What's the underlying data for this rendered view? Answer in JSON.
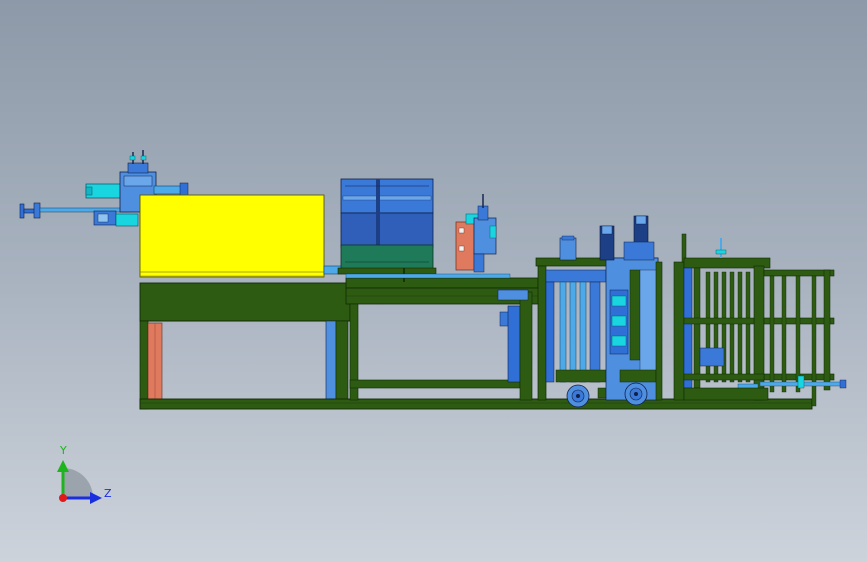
{
  "viewport": {
    "background_top": "#8d99a8",
    "background_bottom": "#cdd3db"
  },
  "colors": {
    "frame_green": "#2e5b12",
    "frame_dark": "#1c3a08",
    "yellow_housing": "#ffff00",
    "blue_unit": "#2f6fd6",
    "light_blue": "#4ea9e8",
    "cyan": "#19d5e0",
    "teal": "#1f7a5a",
    "salmon": "#e07a5f"
  },
  "triad": {
    "y_label": "Y",
    "z_label": "Z",
    "y_color": "#1db41d",
    "z_color": "#1a2ee0",
    "origin_color": "#e01a1a"
  }
}
